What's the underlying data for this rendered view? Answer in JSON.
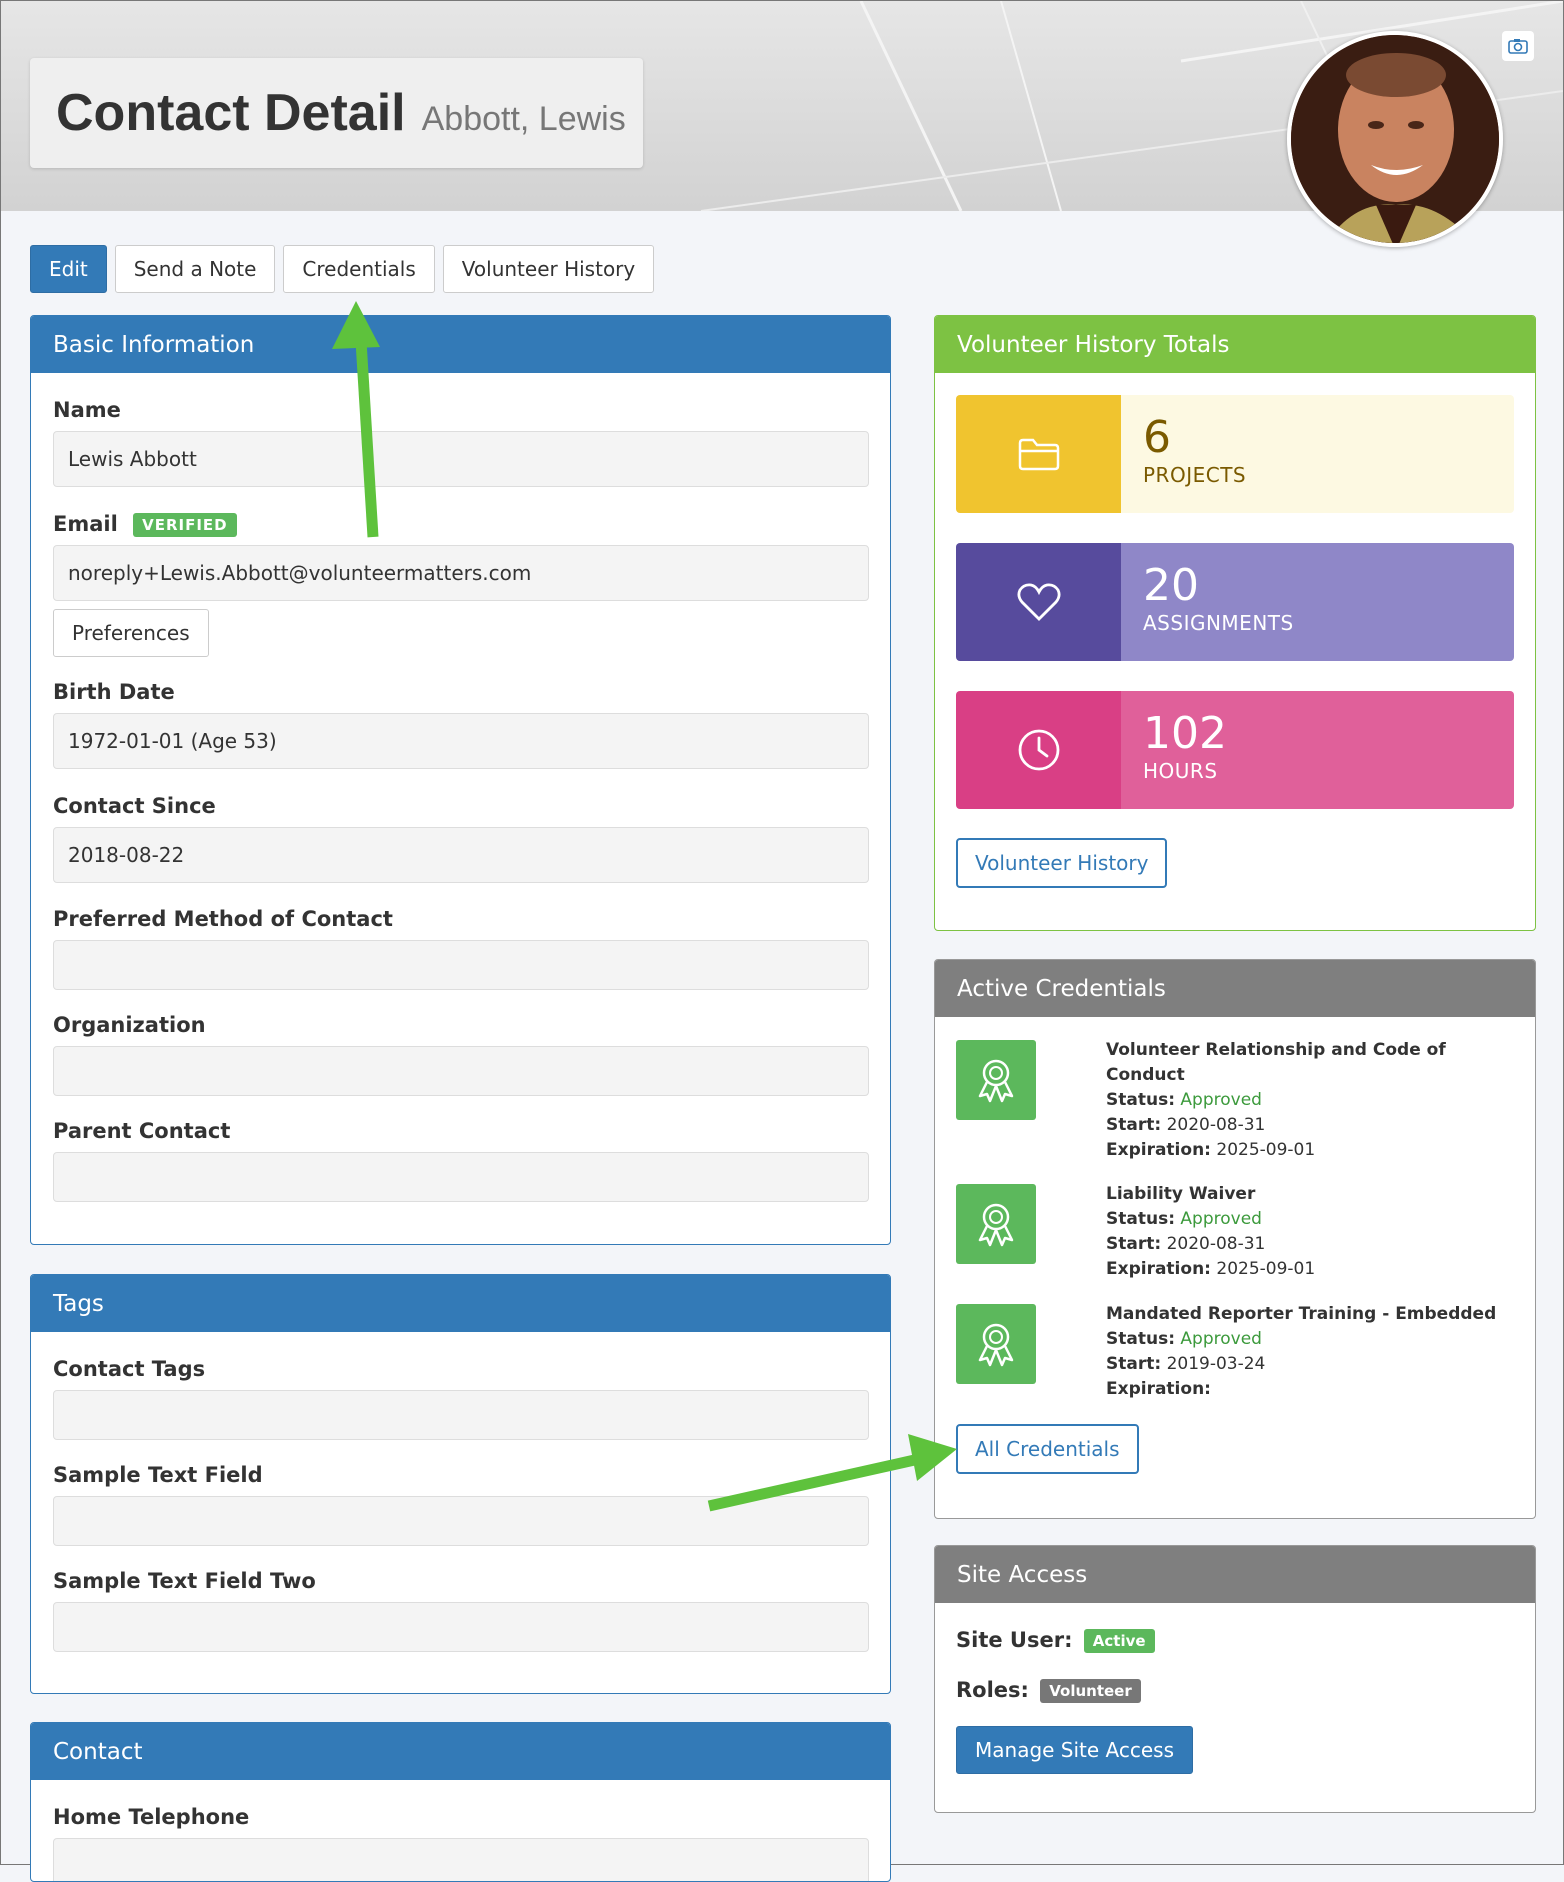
{
  "header": {
    "title": "Contact Detail",
    "subtitle": "Abbott, Lewis",
    "camera_icon": "camera-icon"
  },
  "actions": {
    "edit": "Edit",
    "send_note": "Send a Note",
    "credentials": "Credentials",
    "volunteer_history": "Volunteer History"
  },
  "basic_info": {
    "heading": "Basic Information",
    "name_label": "Name",
    "name_value": "Lewis Abbott",
    "email_label": "Email",
    "email_badge": "VERIFIED",
    "email_value": "noreply+Lewis.Abbott@volunteermatters.com",
    "preferences": "Preferences",
    "birth_label": "Birth Date",
    "birth_value": "1972-01-01 (Age 53)",
    "since_label": "Contact Since",
    "since_value": "2018-08-22",
    "method_label": "Preferred Method of Contact",
    "method_value": "",
    "org_label": "Organization",
    "org_value": "",
    "parent_label": "Parent Contact",
    "parent_value": ""
  },
  "tags": {
    "heading": "Tags",
    "contact_tags_label": "Contact Tags",
    "sample_label": "Sample Text Field",
    "sample_two_label": "Sample Text Field Two"
  },
  "contact": {
    "heading": "Contact",
    "home_phone_label": "Home Telephone"
  },
  "totals": {
    "heading": "Volunteer History Totals",
    "projects_value": "6",
    "projects_label": "PROJECTS",
    "assignments_value": "20",
    "assignments_label": "ASSIGNMENTS",
    "hours_value": "102",
    "hours_label": "HOURS",
    "button": "Volunteer History",
    "colors": {
      "projects_icon_bg": "#f0c42f",
      "projects_text_bg": "#fdf9e2",
      "projects_text": "#7a5a00",
      "assignments_icon_bg": "#574b9d",
      "assignments_text_bg": "#8f87c8",
      "hours_icon_bg": "#d93f85",
      "hours_text_bg": "#e0609a"
    }
  },
  "credentials": {
    "heading": "Active Credentials",
    "status_label": "Status:",
    "start_label": "Start:",
    "expiration_label": "Expiration:",
    "items": [
      {
        "title": "Volunteer Relationship and Code of Conduct",
        "status": "Approved",
        "start": "2020-08-31",
        "expiration": "2025-09-01"
      },
      {
        "title": "Liability Waiver",
        "status": "Approved",
        "start": "2020-08-31",
        "expiration": "2025-09-01"
      },
      {
        "title": "Mandated Reporter Training - Embedded",
        "status": "Approved",
        "start": "2019-03-24",
        "expiration": ""
      }
    ],
    "button": "All Credentials"
  },
  "site_access": {
    "heading": "Site Access",
    "site_user_label": "Site User:",
    "site_user_badge": "Active",
    "roles_label": "Roles:",
    "roles_badge": "Volunteer",
    "button": "Manage Site Access"
  }
}
